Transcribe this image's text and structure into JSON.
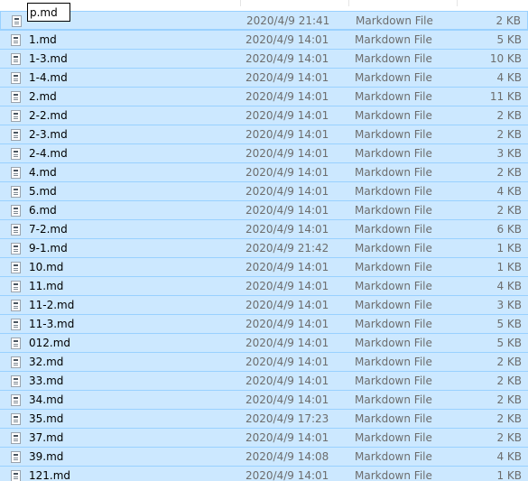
{
  "file_list": {
    "rename_value": "p.md",
    "rows": [
      {
        "name": "p.md",
        "date": "2020/4/9 21:41",
        "type": "Markdown File",
        "size": "2 KB",
        "icon": "markdown-file-icon"
      },
      {
        "name": "1.md",
        "date": "2020/4/9 14:01",
        "type": "Markdown File",
        "size": "5 KB",
        "icon": "markdown-file-icon"
      },
      {
        "name": "1-3.md",
        "date": "2020/4/9 14:01",
        "type": "Markdown File",
        "size": "10 KB",
        "icon": "markdown-file-icon"
      },
      {
        "name": "1-4.md",
        "date": "2020/4/9 14:01",
        "type": "Markdown File",
        "size": "4 KB",
        "icon": "markdown-file-icon"
      },
      {
        "name": "2.md",
        "date": "2020/4/9 14:01",
        "type": "Markdown File",
        "size": "11 KB",
        "icon": "markdown-file-icon"
      },
      {
        "name": "2-2.md",
        "date": "2020/4/9 14:01",
        "type": "Markdown File",
        "size": "2 KB",
        "icon": "markdown-file-icon"
      },
      {
        "name": "2-3.md",
        "date": "2020/4/9 14:01",
        "type": "Markdown File",
        "size": "2 KB",
        "icon": "markdown-file-icon"
      },
      {
        "name": "2-4.md",
        "date": "2020/4/9 14:01",
        "type": "Markdown File",
        "size": "3 KB",
        "icon": "markdown-file-icon"
      },
      {
        "name": "4.md",
        "date": "2020/4/9 14:01",
        "type": "Markdown File",
        "size": "2 KB",
        "icon": "markdown-file-icon"
      },
      {
        "name": "5.md",
        "date": "2020/4/9 14:01",
        "type": "Markdown File",
        "size": "4 KB",
        "icon": "markdown-file-icon"
      },
      {
        "name": "6.md",
        "date": "2020/4/9 14:01",
        "type": "Markdown File",
        "size": "2 KB",
        "icon": "markdown-file-icon"
      },
      {
        "name": "7-2.md",
        "date": "2020/4/9 14:01",
        "type": "Markdown File",
        "size": "6 KB",
        "icon": "markdown-file-icon"
      },
      {
        "name": "9-1.md",
        "date": "2020/4/9 21:42",
        "type": "Markdown File",
        "size": "1 KB",
        "icon": "markdown-file-icon"
      },
      {
        "name": "10.md",
        "date": "2020/4/9 14:01",
        "type": "Markdown File",
        "size": "1 KB",
        "icon": "markdown-file-icon"
      },
      {
        "name": "11.md",
        "date": "2020/4/9 14:01",
        "type": "Markdown File",
        "size": "4 KB",
        "icon": "markdown-file-icon"
      },
      {
        "name": "11-2.md",
        "date": "2020/4/9 14:01",
        "type": "Markdown File",
        "size": "3 KB",
        "icon": "markdown-file-icon"
      },
      {
        "name": "11-3.md",
        "date": "2020/4/9 14:01",
        "type": "Markdown File",
        "size": "5 KB",
        "icon": "markdown-file-icon"
      },
      {
        "name": "012.md",
        "date": "2020/4/9 14:01",
        "type": "Markdown File",
        "size": "5 KB",
        "icon": "markdown-file-icon"
      },
      {
        "name": "32.md",
        "date": "2020/4/9 14:01",
        "type": "Markdown File",
        "size": "2 KB",
        "icon": "markdown-file-icon"
      },
      {
        "name": "33.md",
        "date": "2020/4/9 14:01",
        "type": "Markdown File",
        "size": "2 KB",
        "icon": "markdown-file-icon"
      },
      {
        "name": "34.md",
        "date": "2020/4/9 14:01",
        "type": "Markdown File",
        "size": "2 KB",
        "icon": "markdown-file-icon"
      },
      {
        "name": "35.md",
        "date": "2020/4/9 17:23",
        "type": "Markdown File",
        "size": "2 KB",
        "icon": "markdown-file-icon"
      },
      {
        "name": "37.md",
        "date": "2020/4/9 14:01",
        "type": "Markdown File",
        "size": "2 KB",
        "icon": "markdown-file-icon"
      },
      {
        "name": "39.md",
        "date": "2020/4/9 14:08",
        "type": "Markdown File",
        "size": "4 KB",
        "icon": "markdown-file-icon"
      },
      {
        "name": "121.md",
        "date": "2020/4/9 14:01",
        "type": "Markdown File",
        "size": "1 KB",
        "icon": "markdown-file-icon"
      }
    ]
  },
  "colors": {
    "selection_fill": "#cce8ff",
    "selection_border": "#99d1ff",
    "secondary_text": "#6d6d6d"
  }
}
